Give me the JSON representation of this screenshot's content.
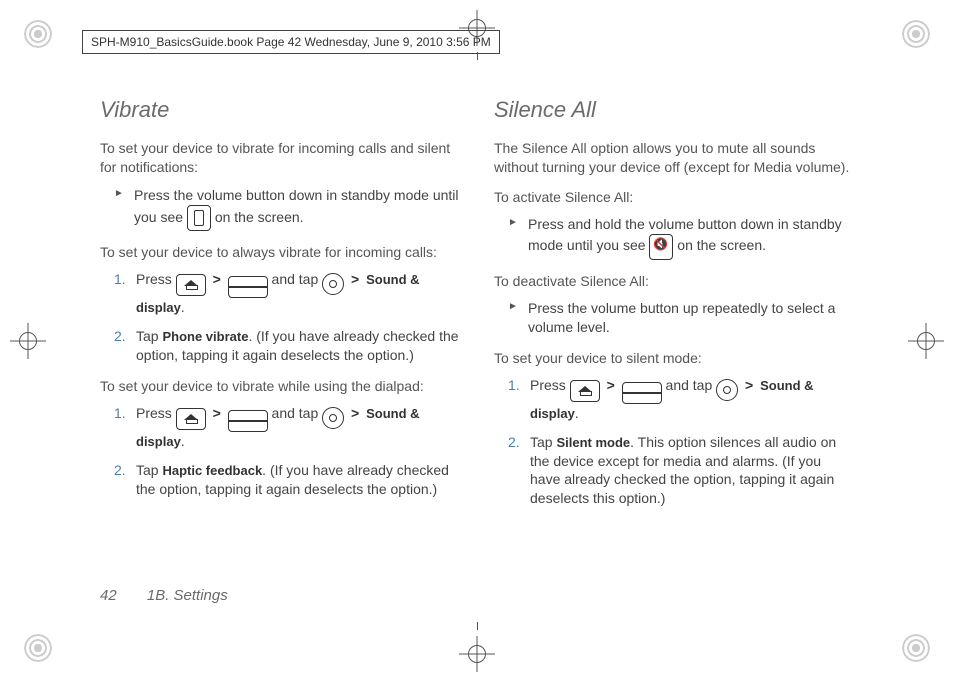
{
  "header": {
    "doc_info": "SPH-M910_BasicsGuide.book  Page 42  Wednesday, June 9, 2010  3:56 PM"
  },
  "left": {
    "title": "Vibrate",
    "intro": "To set your device to vibrate for incoming calls and silent for notifications:",
    "b1_pre": "Press the volume button down in standby mode until you see ",
    "b1_post": " on the screen.",
    "sub1": "To set your device to always vibrate for incoming calls:",
    "s1_press": "Press ",
    "s1_andtap": " and tap ",
    "s1_target": "Sound & display",
    "s1_end": ".",
    "s2_pre": "Tap ",
    "s2_term": "Phone vibrate",
    "s2_post": ". (If you have already checked the option, tapping it again deselects the option.)",
    "sub2": "To set your device to vibrate while using the dialpad:",
    "s3_press": "Press ",
    "s3_andtap": " and tap ",
    "s3_target": "Sound & display",
    "s3_end": ".",
    "s4_pre": "Tap ",
    "s4_term": "Haptic feedback",
    "s4_post": ". (If you have already checked the option, tapping it again deselects the option.)"
  },
  "right": {
    "title": "Silence All",
    "intro": "The Silence All option allows you to mute all sounds without turning your device off (except for Media volume).",
    "sub1": "To activate Silence All:",
    "b1_pre": "Press and hold the volume button down in standby mode until you see ",
    "b1_post": " on the screen.",
    "sub2": "To deactivate Silence All:",
    "b2": "Press the volume button up repeatedly to select a volume level.",
    "sub3": "To set your device to silent mode:",
    "s1_press": "Press ",
    "s1_andtap": " and tap ",
    "s1_target": "Sound & display",
    "s1_end": ".",
    "s2_pre": "Tap ",
    "s2_term": "Silent mode",
    "s2_post": ". This option silences all audio on the device except for media and alarms. (If you have already checked the option, tapping it again deselects this option.)"
  },
  "footer": {
    "page_number": "42",
    "section": "1B. Settings"
  },
  "glyphs": {
    "gt": ">"
  }
}
